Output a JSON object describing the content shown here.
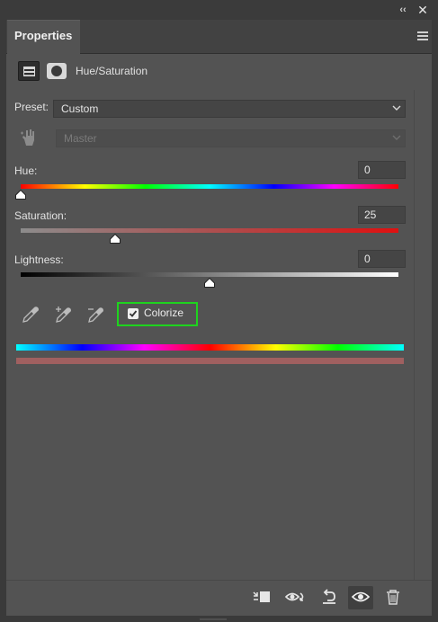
{
  "window": {
    "collapse_icon": "double-chevron-left-icon",
    "close_icon": "close-icon"
  },
  "panel": {
    "tab_label": "Properties",
    "menu_icon": "panel-menu-icon"
  },
  "adjustment": {
    "title": "Hue/Saturation",
    "mode_icons": [
      "adjustment-layer-icon",
      "mask-icon"
    ]
  },
  "preset": {
    "label": "Preset:",
    "value": "Custom"
  },
  "channel": {
    "value": "Master",
    "disabled": true
  },
  "hue": {
    "label": "Hue:",
    "value": "0",
    "level": 0
  },
  "saturation": {
    "label": "Saturation:",
    "value": "25",
    "level": 0.25
  },
  "lightness": {
    "label": "Lightness:",
    "value": "0",
    "level": 0.5
  },
  "colorize": {
    "label": "Colorize",
    "checked": true,
    "highlight_color": "#1ed31e"
  },
  "droppers": [
    "eyedropper-icon",
    "eyedropper-add-icon",
    "eyedropper-subtract-icon"
  ],
  "colors": {
    "panel_bg": "#535353",
    "colorize_tint": "#a06060"
  },
  "footer_icons": [
    "clip-to-layer-icon",
    "view-previous-state-icon",
    "reset-icon",
    "visibility-eye-icon",
    "trash-icon"
  ]
}
